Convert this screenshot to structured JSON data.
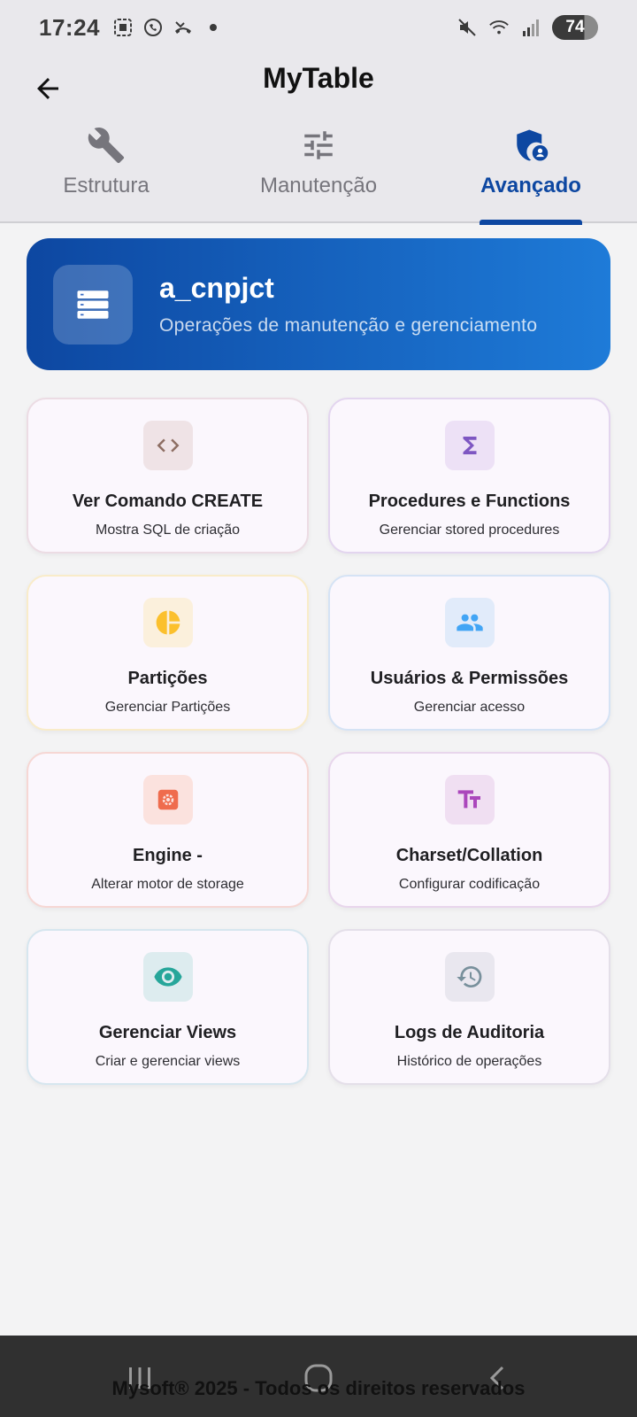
{
  "status": {
    "time": "17:24",
    "battery": "74",
    "left_icons": [
      "gallery-icon",
      "whatsapp-icon",
      "missed-call-icon",
      "dot-icon"
    ],
    "right_icons": [
      "mute-icon",
      "wifi-icon",
      "signal-icon",
      "battery-icon"
    ]
  },
  "app": {
    "title": "MyTable"
  },
  "tabs": [
    {
      "label": "Estrutura",
      "icon": "wrench-icon"
    },
    {
      "label": "Manutenção",
      "icon": "sliders-icon"
    },
    {
      "label": "Avançado",
      "icon": "shield-user-icon",
      "active": true
    }
  ],
  "header": {
    "title": "a_cnpjct",
    "subtitle": "Operações de manutenção e gerenciamento",
    "icon": "list-icon"
  },
  "cards": [
    {
      "title": "Ver Comando CREATE",
      "subtitle": "Mostra SQL de criação",
      "icon": "code-icon",
      "accent": "#8d6e63"
    },
    {
      "title": "Procedures e Functions",
      "subtitle": "Gerenciar stored procedures",
      "icon": "sigma-icon",
      "accent": "#7e57c2"
    },
    {
      "title": "Partições",
      "subtitle": "Gerenciar Partições",
      "icon": "pie-chart-icon",
      "accent": "#fbc02d"
    },
    {
      "title": "Usuários & Permissões",
      "subtitle": "Gerenciar acesso",
      "icon": "people-icon",
      "accent": "#42a5f5"
    },
    {
      "title": "Engine -",
      "subtitle": "Alterar motor de storage",
      "icon": "engine-icon",
      "accent": "#ef6c4d"
    },
    {
      "title": "Charset/Collation",
      "subtitle": "Configurar codificação",
      "icon": "text-size-icon",
      "accent": "#ab47bc"
    },
    {
      "title": "Gerenciar Views",
      "subtitle": "Criar e gerenciar views",
      "icon": "eye-icon",
      "accent": "#26a69a"
    },
    {
      "title": "Logs de Auditoria",
      "subtitle": "Histórico de operações",
      "icon": "history-icon",
      "accent": "#78909c"
    }
  ],
  "footer": {
    "text": "Mysoft® 2025 - Todos os direitos reservados"
  },
  "nav": {
    "recents_icon": "recents-icon",
    "home_icon": "home-icon",
    "back_icon": "nav-back-icon"
  }
}
